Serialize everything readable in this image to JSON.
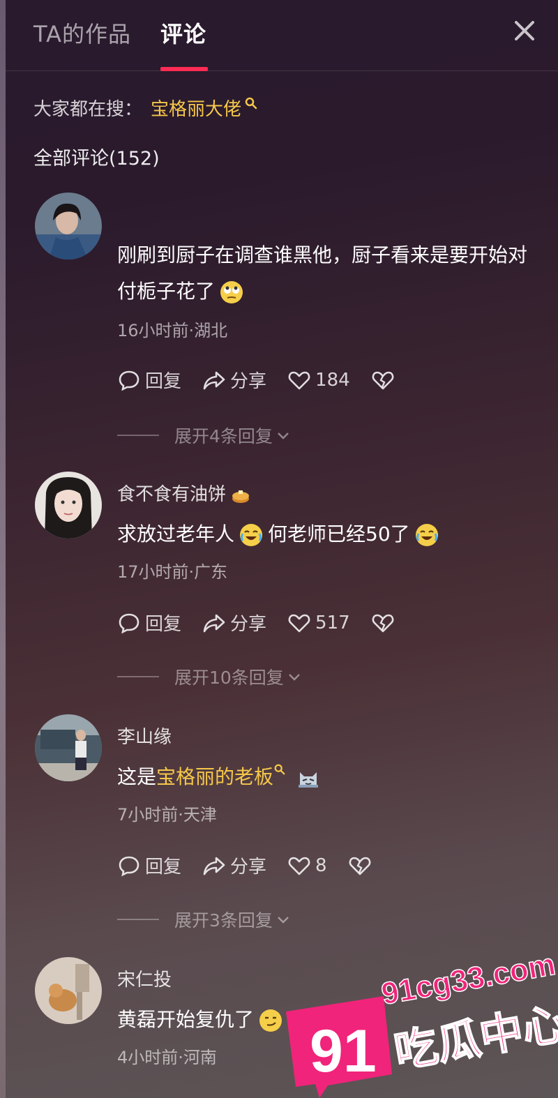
{
  "header": {
    "tab_works": "TA的作品",
    "tab_comments": "评论"
  },
  "search": {
    "prefix": "大家都在搜：",
    "keyword": "宝格丽大佬"
  },
  "comments_total": "全部评论(152)",
  "comments": [
    {
      "user": "",
      "text": "刚刷到厨子在调查谁黑他，厨子看来是要开始对付栀子花了",
      "meta": "16小时前·湖北",
      "reply": "回复",
      "share": "分享",
      "likes": "184",
      "expand": "展开4条回复"
    },
    {
      "user": "食不食有油饼",
      "text_a": "求放过老年人",
      "text_b": "何老师已经50了",
      "meta": "17小时前·广东",
      "reply": "回复",
      "share": "分享",
      "likes": "517",
      "expand": "展开10条回复"
    },
    {
      "user": "李山缘",
      "text_a": "这是",
      "text_link": "宝格丽的老板",
      "meta": "7小时前·天津",
      "reply": "回复",
      "share": "分享",
      "likes": "8",
      "expand": "展开3条回复"
    },
    {
      "user": "宋仁投",
      "text": "黄磊开始复仇了",
      "meta": "4小时前·河南"
    }
  ],
  "watermark": {
    "domain": "91cg33.com",
    "number": "91",
    "name": "吃瓜中心"
  }
}
